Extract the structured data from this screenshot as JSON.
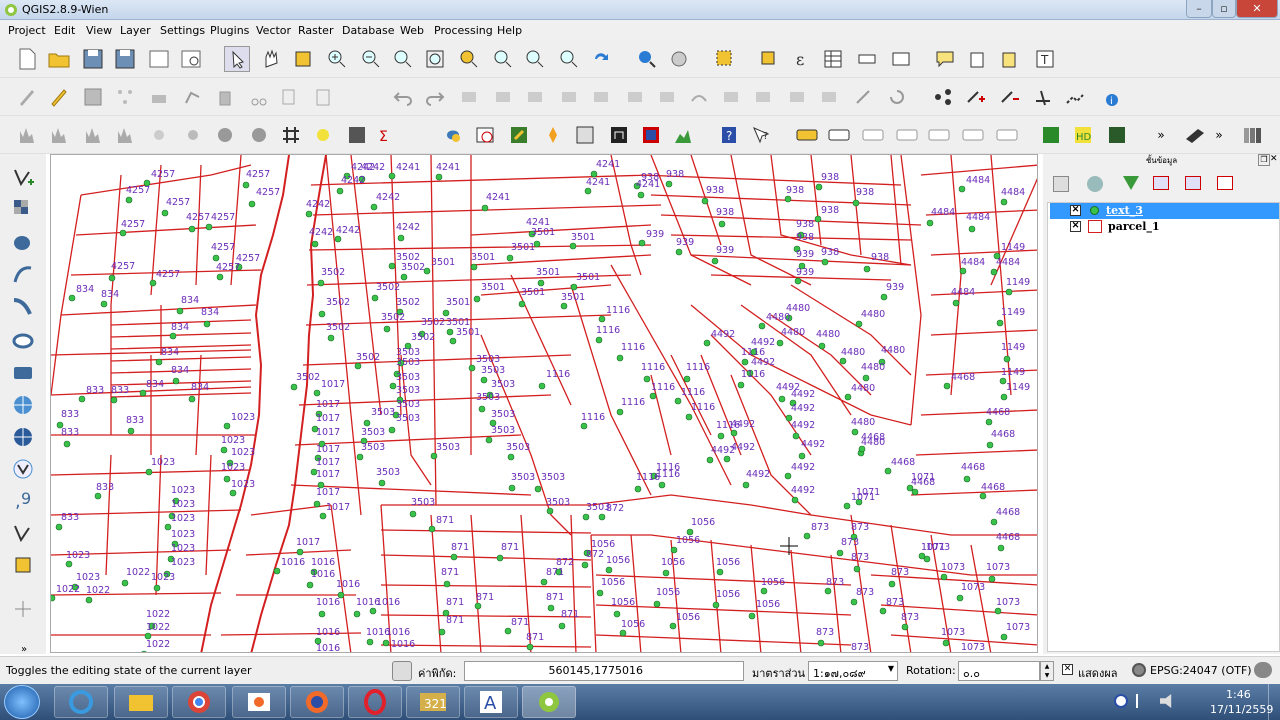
{
  "window": {
    "title": "QGIS2.8.9-Wien"
  },
  "menu": [
    "Project",
    "Edit",
    "View",
    "Layer",
    "Settings",
    "Plugins",
    "Vector",
    "Raster",
    "Database",
    "Web",
    "Processing",
    "Help"
  ],
  "layers_panel": {
    "title": "ชั้นข้อมูล",
    "layers": [
      {
        "name": "text_3",
        "checked": true,
        "selected": true,
        "symbol": "point"
      },
      {
        "name": "parcel_1",
        "checked": true,
        "selected": false,
        "symbol": "polygon"
      }
    ]
  },
  "map_labels": [
    "4257",
    "4242",
    "4241",
    "938",
    "4484",
    "3502",
    "3501",
    "1149",
    "939",
    "834",
    "833",
    "4480",
    "1116",
    "4492",
    "1023",
    "3503",
    "4468",
    "1017",
    "1071",
    "1022",
    "1016",
    "871",
    "872",
    "1056",
    "873",
    "1073"
  ],
  "status": {
    "message": "Toggles the editing state of the current layer",
    "coord_label": "ค่าพิกัด:",
    "coord_value": "560145,1775016",
    "scale_label": "มาตราส่วน",
    "scale_value": "1:๑๗,๐๘๙",
    "rotation_label": "Rotation:",
    "rotation_value": "๐.๐",
    "render_label": "แสดงผล",
    "crs": "EPSG:24047 (OTF)"
  },
  "taskbar": {
    "time": "1:46",
    "date": "17/11/2559"
  },
  "colors": {
    "parcel_line": "#d31f1f",
    "label": "#6a2bb8",
    "point": "#39c24a"
  }
}
